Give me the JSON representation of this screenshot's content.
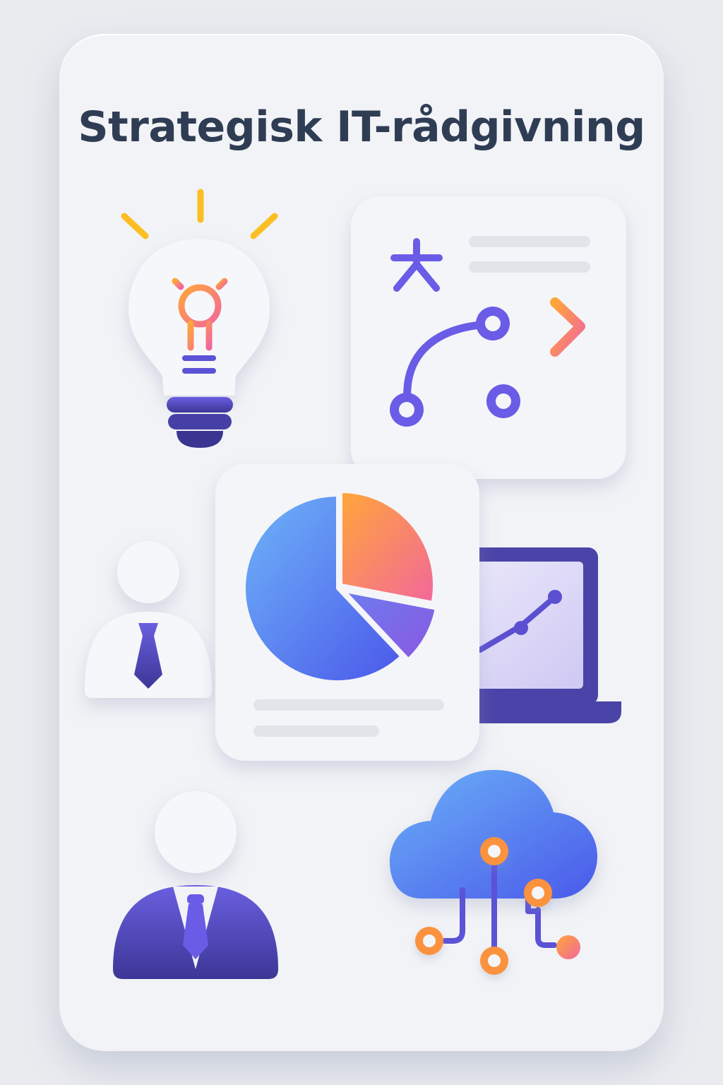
{
  "title": "Strategisk IT-rådgivning",
  "icons": [
    "lightbulb-gear-icon",
    "strategy-board-icon",
    "pie-chart-report-icon",
    "laptop-growth-chart-icon",
    "consultant-person-icon",
    "business-person-icon",
    "cloud-network-icon"
  ],
  "colors": {
    "title": "#2f3d54",
    "card": "#f2f3f6",
    "indigo": "#4a44a8",
    "violet": "#6a5ce6",
    "blue": "#4d6ff2",
    "orange": "#fb923c",
    "pink": "#f472b6"
  },
  "chart_data": {
    "type": "pie",
    "values": [
      28,
      10,
      62
    ]
  }
}
